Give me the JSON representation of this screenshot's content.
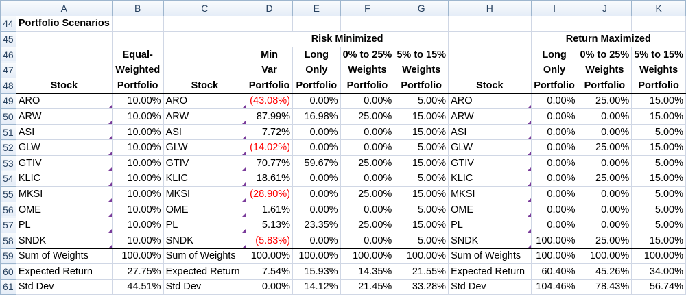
{
  "columns": [
    "A",
    "B",
    "C",
    "D",
    "E",
    "F",
    "G",
    "H",
    "I",
    "J",
    "K"
  ],
  "title": "Portfolio Scenarios",
  "group_risk": "Risk Minimized",
  "group_return": "Return Maximized",
  "header_rows": {
    "r46": [
      "",
      "Equal-",
      "",
      "Min",
      "Long",
      "0% to 25%",
      "5% to 15%",
      "",
      "Long",
      "0% to 25%",
      "5% to 15%"
    ],
    "r47": [
      "",
      "Weighted",
      "",
      "Var",
      "Only",
      "Weights",
      "Weights",
      "",
      "Only",
      "Weights",
      "Weights"
    ],
    "r48": [
      "Stock",
      "Portfolio",
      "Stock",
      "Portfolio",
      "Portfolio",
      "Portfolio",
      "Portfolio",
      "Stock",
      "Portfolio",
      "Portfolio",
      "Portfolio"
    ]
  },
  "data_rows": [
    {
      "row": "49",
      "cells": [
        "ARO",
        "10.00%",
        "ARO",
        "(43.08%)",
        "0.00%",
        "0.00%",
        "5.00%",
        "ARO",
        "0.00%",
        "25.00%",
        "15.00%"
      ]
    },
    {
      "row": "50",
      "cells": [
        "ARW",
        "10.00%",
        "ARW",
        "87.99%",
        "16.98%",
        "25.00%",
        "15.00%",
        "ARW",
        "0.00%",
        "0.00%",
        "15.00%"
      ]
    },
    {
      "row": "51",
      "cells": [
        "ASI",
        "10.00%",
        "ASI",
        "7.72%",
        "0.00%",
        "0.00%",
        "15.00%",
        "ASI",
        "0.00%",
        "0.00%",
        "5.00%"
      ]
    },
    {
      "row": "52",
      "cells": [
        "GLW",
        "10.00%",
        "GLW",
        "(14.02%)",
        "0.00%",
        "0.00%",
        "5.00%",
        "GLW",
        "0.00%",
        "25.00%",
        "15.00%"
      ]
    },
    {
      "row": "53",
      "cells": [
        "GTIV",
        "10.00%",
        "GTIV",
        "70.77%",
        "59.67%",
        "25.00%",
        "15.00%",
        "GTIV",
        "0.00%",
        "0.00%",
        "5.00%"
      ]
    },
    {
      "row": "54",
      "cells": [
        "KLIC",
        "10.00%",
        "KLIC",
        "18.61%",
        "0.00%",
        "0.00%",
        "5.00%",
        "KLIC",
        "0.00%",
        "25.00%",
        "15.00%"
      ]
    },
    {
      "row": "55",
      "cells": [
        "MKSI",
        "10.00%",
        "MKSI",
        "(28.90%)",
        "0.00%",
        "25.00%",
        "15.00%",
        "MKSI",
        "0.00%",
        "0.00%",
        "5.00%"
      ]
    },
    {
      "row": "56",
      "cells": [
        "OME",
        "10.00%",
        "OME",
        "1.61%",
        "0.00%",
        "0.00%",
        "5.00%",
        "OME",
        "0.00%",
        "0.00%",
        "5.00%"
      ]
    },
    {
      "row": "57",
      "cells": [
        "PL",
        "10.00%",
        "PL",
        "5.13%",
        "23.35%",
        "25.00%",
        "15.00%",
        "PL",
        "0.00%",
        "0.00%",
        "5.00%"
      ]
    },
    {
      "row": "58",
      "cells": [
        "SNDK",
        "10.00%",
        "SNDK",
        "(5.83%)",
        "0.00%",
        "0.00%",
        "5.00%",
        "SNDK",
        "100.00%",
        "25.00%",
        "15.00%"
      ]
    }
  ],
  "summary_rows": [
    {
      "row": "59",
      "cells": [
        "Sum of Weights",
        "100.00%",
        "Sum of Weights",
        "100.00%",
        "100.00%",
        "100.00%",
        "100.00%",
        "Sum of Weights",
        "100.00%",
        "100.00%",
        "100.00%"
      ]
    },
    {
      "row": "60",
      "cells": [
        "Expected Return",
        "27.75%",
        "Expected Return",
        "7.54%",
        "15.93%",
        "14.35%",
        "21.55%",
        "Expected Return",
        "60.40%",
        "45.26%",
        "34.00%"
      ]
    },
    {
      "row": "61",
      "cells": [
        "Std Dev",
        "44.51%",
        "Std Dev",
        "0.00%",
        "14.12%",
        "21.45%",
        "33.28%",
        "Std Dev",
        "104.46%",
        "78.43%",
        "56.74%"
      ]
    }
  ],
  "colors": {
    "negative": "#ff0000",
    "comment_marker": "#7a3b9a",
    "header_text": "#27415f"
  }
}
